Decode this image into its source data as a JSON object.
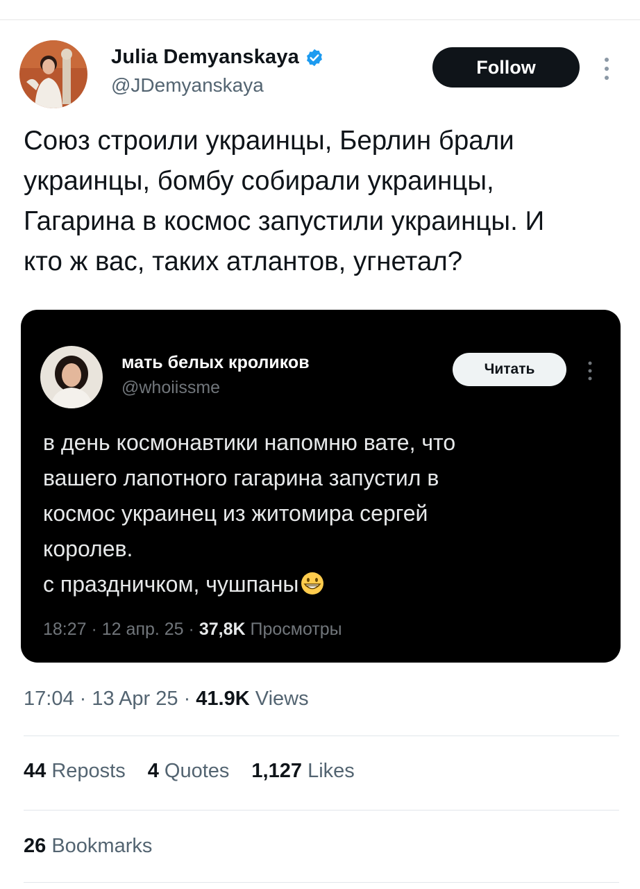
{
  "author": {
    "name": "Julia Demyanskaya",
    "handle": "@JDemyanskaya",
    "follow_label": "Follow"
  },
  "tweet": {
    "text": "Союз строили украинцы, Берлин брали\nукраинцы, бомбу собирали украинцы,\nГагарина в космос запустили украинцы. И\nкто ж вас, таких атлантов, угнетал?",
    "time": "17:04",
    "date": "13 Apr 25",
    "views_count": "41.9K",
    "views_label": "Views"
  },
  "embedded": {
    "name": "мать белых кроликов",
    "handle": "@whoiissme",
    "read_label": "Читать",
    "lines": [
      "в день космонавтики напомню вате, что",
      "вашего лапотного гагарина запустил в",
      "космос украинец из житомира сергей",
      "королев.",
      "с праздничком, чушпаны"
    ],
    "time": "18:27",
    "date": "12 апр. 25",
    "views_count": "37,8K",
    "views_label": "Просмотры"
  },
  "stats": {
    "reposts_count": "44",
    "reposts_label": "Reposts",
    "quotes_count": "4",
    "quotes_label": "Quotes",
    "likes_count": "1,127",
    "likes_label": "Likes",
    "bookmarks_count": "26",
    "bookmarks_label": "Bookmarks"
  },
  "colors": {
    "verified": "#1d9bf0",
    "follow_bg": "#0f1419",
    "secondary_text": "#536471",
    "embed_bg": "#000000"
  }
}
